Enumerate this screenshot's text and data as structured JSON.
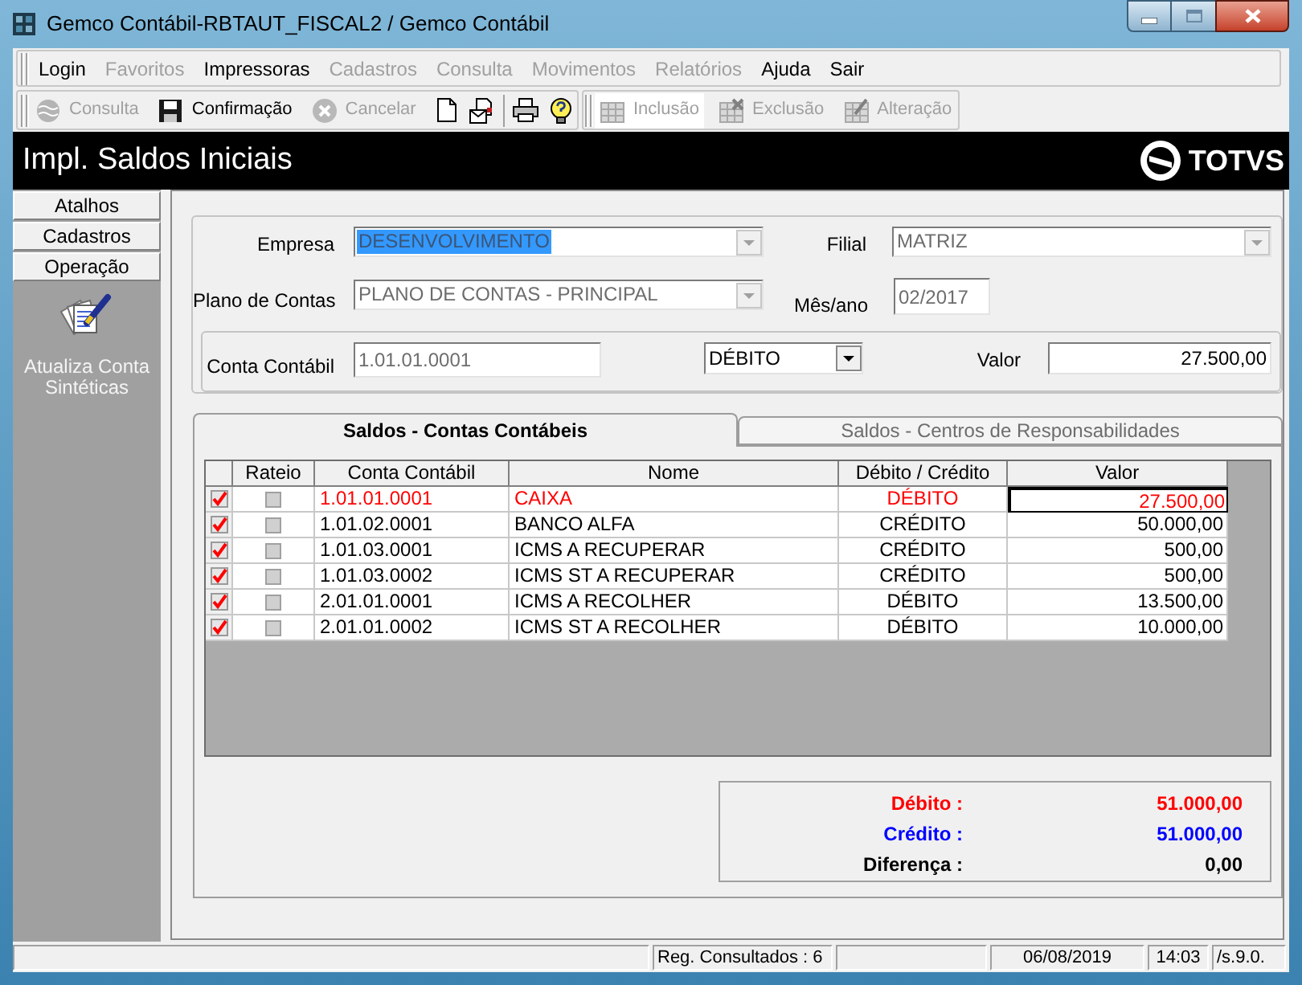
{
  "window": {
    "title": "Gemco Contábil-RBTAUT_FISCAL2 / Gemco Contábil"
  },
  "menu": [
    {
      "label": "Login",
      "disabled": false
    },
    {
      "label": "Favoritos",
      "disabled": true
    },
    {
      "label": "Impressoras",
      "disabled": false
    },
    {
      "label": "Cadastros",
      "disabled": true
    },
    {
      "label": "Consulta",
      "disabled": true
    },
    {
      "label": "Movimentos",
      "disabled": true
    },
    {
      "label": "Relatórios",
      "disabled": true
    },
    {
      "label": "Ajuda",
      "disabled": false
    },
    {
      "label": "Sair",
      "disabled": false
    }
  ],
  "toolbar": {
    "record_actions": [
      {
        "label": "Consulta",
        "disabled": true
      },
      {
        "label": "Confirmação",
        "disabled": false
      },
      {
        "label": "Cancelar",
        "disabled": true
      }
    ],
    "edit_actions": [
      {
        "label": "Inclusão",
        "disabled": true,
        "hovered": true
      },
      {
        "label": "Exclusão",
        "disabled": true
      },
      {
        "label": "Alteração",
        "disabled": true
      }
    ]
  },
  "header": {
    "title": "Impl. Saldos Iniciais",
    "logo": "TOTVS"
  },
  "sidebar": {
    "sections": [
      "Atalhos",
      "Cadastros",
      "Operação"
    ],
    "items": [
      {
        "label": "Atualiza Conta Sintéticas"
      }
    ]
  },
  "form": {
    "empresa": {
      "label": "Empresa",
      "value": "DESENVOLVIMENTO",
      "disabled": true,
      "highlighted": true
    },
    "filial": {
      "label": "Filial",
      "value": "MATRIZ",
      "disabled": true
    },
    "plano_de_contas": {
      "label": "Plano de Contas",
      "value": "PLANO DE CONTAS - PRINCIPAL",
      "disabled": true
    },
    "mes_ano": {
      "label": "Mês/ano",
      "value": "02/2017",
      "disabled": true
    },
    "conta_contabil": {
      "label": "Conta Contábil",
      "value": "1.01.01.0001",
      "disabled": true
    },
    "dropdown": {
      "value": "DÉBITO",
      "disabled": false
    },
    "valor": {
      "label": "Valor",
      "value": "27.500,00",
      "disabled": false
    }
  },
  "tabs": [
    {
      "label": "Saldos - Contas Contábeis",
      "selected": true
    },
    {
      "label": "Saldos - Centros de Responsabilidades",
      "selected": false
    }
  ],
  "table": {
    "columns": [
      "Rateio",
      "Conta Contábil",
      "Nome",
      "Débito / Crédito",
      "Valor"
    ],
    "rows": [
      {
        "checked": true,
        "rateio": false,
        "conta": "1.01.01.0001",
        "nome": "CAIXA",
        "tipo": "DÉBITO",
        "valor": "27.500,00",
        "selected": true
      },
      {
        "checked": true,
        "rateio": false,
        "conta": "1.01.02.0001",
        "nome": "BANCO ALFA",
        "tipo": "CRÉDITO",
        "valor": "50.000,00",
        "selected": false
      },
      {
        "checked": true,
        "rateio": false,
        "conta": "1.01.03.0001",
        "nome": "ICMS A RECUPERAR",
        "tipo": "CRÉDITO",
        "valor": "500,00",
        "selected": false
      },
      {
        "checked": true,
        "rateio": false,
        "conta": "1.01.03.0002",
        "nome": "ICMS ST A RECUPERAR",
        "tipo": "CRÉDITO",
        "valor": "500,00",
        "selected": false
      },
      {
        "checked": true,
        "rateio": false,
        "conta": "2.01.01.0001",
        "nome": "ICMS A RECOLHER",
        "tipo": "DÉBITO",
        "valor": "13.500,00",
        "selected": false
      },
      {
        "checked": true,
        "rateio": false,
        "conta": "2.01.01.0002",
        "nome": "ICMS ST A RECOLHER",
        "tipo": "DÉBITO",
        "valor": "10.000,00",
        "selected": false
      }
    ]
  },
  "totals": [
    {
      "label": "Débito :",
      "value": "51.000,00",
      "color": "#ff0000"
    },
    {
      "label": "Crédito :",
      "value": "51.000,00",
      "color": "#0000ff"
    },
    {
      "label": "Diferença :",
      "value": "0,00",
      "color": "#000000"
    }
  ],
  "status_bar": {
    "records": "Reg. Consultados : 6",
    "date": "06/08/2019",
    "time": "14:03",
    "version": "/s.9.0."
  }
}
